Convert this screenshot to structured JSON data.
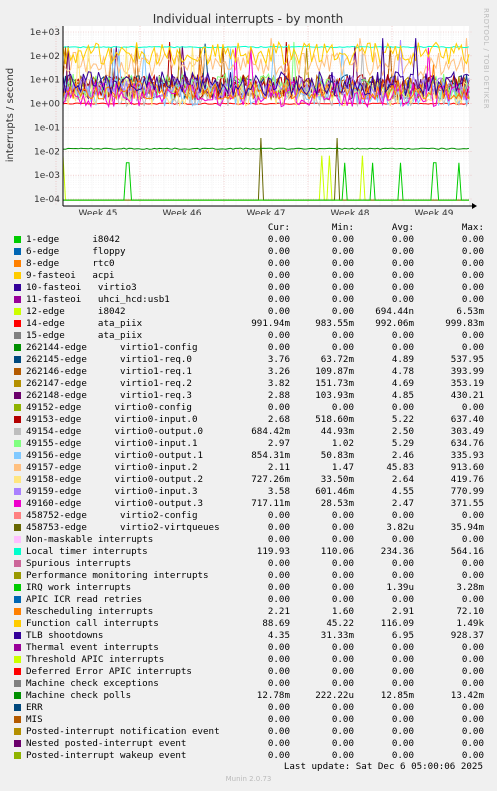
{
  "chart_data": {
    "type": "line",
    "title": "Individual interrupts - by month",
    "ylabel": "interrupts / second",
    "yscale": "log",
    "ylim": [
      0.0001,
      1000
    ],
    "yticks": [
      "1e+03",
      "1e+02",
      "1e+01",
      "1e+00",
      "1e-01",
      "1e-02",
      "1e-03",
      "1e-04"
    ],
    "xticks": [
      "Week 45",
      "Week 46",
      "Week 47",
      "Week 48",
      "Week 49"
    ],
    "grid": true,
    "columns": [
      "Cur:",
      "Min:",
      "Avg:",
      "Max:"
    ],
    "series": [
      {
        "name": "1-edge      i8042",
        "color": "#00cc00",
        "cur": "0.00",
        "min": "0.00",
        "avg": "0.00",
        "max": "0.00"
      },
      {
        "name": "6-edge      floppy",
        "color": "#0066b3",
        "cur": "0.00",
        "min": "0.00",
        "avg": "0.00",
        "max": "0.00"
      },
      {
        "name": "8-edge      rtc0",
        "color": "#ff8000",
        "cur": "0.00",
        "min": "0.00",
        "avg": "0.00",
        "max": "0.00"
      },
      {
        "name": "9-fasteoi   acpi",
        "color": "#ffcc00",
        "cur": "0.00",
        "min": "0.00",
        "avg": "0.00",
        "max": "0.00"
      },
      {
        "name": "10-fasteoi   virtio3",
        "color": "#330099",
        "cur": "0.00",
        "min": "0.00",
        "avg": "0.00",
        "max": "0.00"
      },
      {
        "name": "11-fasteoi   uhci_hcd:usb1",
        "color": "#990099",
        "cur": "0.00",
        "min": "0.00",
        "avg": "0.00",
        "max": "0.00"
      },
      {
        "name": "12-edge      i8042",
        "color": "#ccff00",
        "cur": "0.00",
        "min": "0.00",
        "avg": "694.44n",
        "max": "6.53m"
      },
      {
        "name": "14-edge      ata_piix",
        "color": "#ff0000",
        "cur": "991.94m",
        "min": "983.55m",
        "avg": "992.06m",
        "max": "999.83m"
      },
      {
        "name": "15-edge      ata_piix",
        "color": "#808080",
        "cur": "0.00",
        "min": "0.00",
        "avg": "0.00",
        "max": "0.00"
      },
      {
        "name": "262144-edge      virtio1-config",
        "color": "#008f00",
        "cur": "0.00",
        "min": "0.00",
        "avg": "0.00",
        "max": "0.00"
      },
      {
        "name": "262145-edge      virtio1-req.0",
        "color": "#00487d",
        "cur": "3.76",
        "min": "63.72m",
        "avg": "4.89",
        "max": "537.95"
      },
      {
        "name": "262146-edge      virtio1-req.1",
        "color": "#b35a00",
        "cur": "3.26",
        "min": "109.87m",
        "avg": "4.78",
        "max": "393.99"
      },
      {
        "name": "262147-edge      virtio1-req.2",
        "color": "#b38f00",
        "cur": "3.82",
        "min": "151.73m",
        "avg": "4.69",
        "max": "353.19"
      },
      {
        "name": "262148-edge      virtio1-req.3",
        "color": "#6b006b",
        "cur": "2.88",
        "min": "103.93m",
        "avg": "4.85",
        "max": "430.21"
      },
      {
        "name": "49152-edge      virtio0-config",
        "color": "#8fb300",
        "cur": "0.00",
        "min": "0.00",
        "avg": "0.00",
        "max": "0.00"
      },
      {
        "name": "49153-edge      virtio0-input.0",
        "color": "#b30000",
        "cur": "2.68",
        "min": "518.60m",
        "avg": "5.22",
        "max": "637.40"
      },
      {
        "name": "49154-edge      virtio0-output.0",
        "color": "#bebebe",
        "cur": "684.42m",
        "min": "44.93m",
        "avg": "2.50",
        "max": "303.49"
      },
      {
        "name": "49155-edge      virtio0-input.1",
        "color": "#80ff80",
        "cur": "2.97",
        "min": "1.02",
        "avg": "5.29",
        "max": "634.76"
      },
      {
        "name": "49156-edge      virtio0-output.1",
        "color": "#80c9ff",
        "cur": "854.31m",
        "min": "50.83m",
        "avg": "2.46",
        "max": "335.93"
      },
      {
        "name": "49157-edge      virtio0-input.2",
        "color": "#ffc080",
        "cur": "2.11",
        "min": "1.47",
        "avg": "45.83",
        "max": "913.60"
      },
      {
        "name": "49158-edge      virtio0-output.2",
        "color": "#ffe680",
        "cur": "727.26m",
        "min": "33.50m",
        "avg": "2.64",
        "max": "419.76"
      },
      {
        "name": "49159-edge      virtio0-input.3",
        "color": "#aa80ff",
        "cur": "3.58",
        "min": "601.46m",
        "avg": "4.55",
        "max": "770.99"
      },
      {
        "name": "49160-edge      virtio0-output.3",
        "color": "#ee00cc",
        "cur": "717.11m",
        "min": "28.53m",
        "avg": "2.47",
        "max": "371.55"
      },
      {
        "name": "458752-edge      virtio2-config",
        "color": "#ff8080",
        "cur": "0.00",
        "min": "0.00",
        "avg": "0.00",
        "max": "0.00"
      },
      {
        "name": "458753-edge      virtio2-virtqueues",
        "color": "#666600",
        "cur": "0.00",
        "min": "0.00",
        "avg": "3.82u",
        "max": "35.94m"
      },
      {
        "name": "Non-maskable interrupts",
        "color": "#ffbfff",
        "cur": "0.00",
        "min": "0.00",
        "avg": "0.00",
        "max": "0.00"
      },
      {
        "name": "Local timer interrupts",
        "color": "#00ffcc",
        "cur": "119.93",
        "min": "110.06",
        "avg": "234.36",
        "max": "564.16"
      },
      {
        "name": "Spurious interrupts",
        "color": "#cc6699",
        "cur": "0.00",
        "min": "0.00",
        "avg": "0.00",
        "max": "0.00"
      },
      {
        "name": "Performance monitoring interrupts",
        "color": "#999900",
        "cur": "0.00",
        "min": "0.00",
        "avg": "0.00",
        "max": "0.00"
      },
      {
        "name": "IRQ work interrupts",
        "color": "#00cc00",
        "cur": "0.00",
        "min": "0.00",
        "avg": "1.39u",
        "max": "3.28m"
      },
      {
        "name": "APIC ICR read retries",
        "color": "#0066b3",
        "cur": "0.00",
        "min": "0.00",
        "avg": "0.00",
        "max": "0.00"
      },
      {
        "name": "Rescheduling interrupts",
        "color": "#ff8000",
        "cur": "2.21",
        "min": "1.60",
        "avg": "2.91",
        "max": "72.10"
      },
      {
        "name": "Function call interrupts",
        "color": "#ffcc00",
        "cur": "88.69",
        "min": "45.22",
        "avg": "116.09",
        "max": "1.49k"
      },
      {
        "name": "TLB shootdowns",
        "color": "#330099",
        "cur": "4.35",
        "min": "31.33m",
        "avg": "6.95",
        "max": "928.37"
      },
      {
        "name": "Thermal event interrupts",
        "color": "#990099",
        "cur": "0.00",
        "min": "0.00",
        "avg": "0.00",
        "max": "0.00"
      },
      {
        "name": "Threshold APIC interrupts",
        "color": "#ccff00",
        "cur": "0.00",
        "min": "0.00",
        "avg": "0.00",
        "max": "0.00"
      },
      {
        "name": "Deferred Error APIC interrupts",
        "color": "#ff0000",
        "cur": "0.00",
        "min": "0.00",
        "avg": "0.00",
        "max": "0.00"
      },
      {
        "name": "Machine check exceptions",
        "color": "#808080",
        "cur": "0.00",
        "min": "0.00",
        "avg": "0.00",
        "max": "0.00"
      },
      {
        "name": "Machine check polls",
        "color": "#008f00",
        "cur": "12.78m",
        "min": "222.22u",
        "avg": "12.85m",
        "max": "13.42m"
      },
      {
        "name": "ERR",
        "color": "#00487d",
        "cur": "0.00",
        "min": "0.00",
        "avg": "0.00",
        "max": "0.00"
      },
      {
        "name": "MIS",
        "color": "#b35a00",
        "cur": "0.00",
        "min": "0.00",
        "avg": "0.00",
        "max": "0.00"
      },
      {
        "name": "Posted-interrupt notification event",
        "color": "#b38f00",
        "cur": "0.00",
        "min": "0.00",
        "avg": "0.00",
        "max": "0.00"
      },
      {
        "name": "Nested posted-interrupt event",
        "color": "#6b006b",
        "cur": "0.00",
        "min": "0.00",
        "avg": "0.00",
        "max": "0.00"
      },
      {
        "name": "Posted-interrupt wakeup event",
        "color": "#8fb300",
        "cur": "0.00",
        "min": "0.00",
        "avg": "0.00",
        "max": "0.00"
      }
    ]
  },
  "last_update": "Last update: Sat Dec  6 05:00:06 2025",
  "footer": "Munin 2.0.73",
  "watermark": "RRDTOOL / TOBI OETIKER"
}
